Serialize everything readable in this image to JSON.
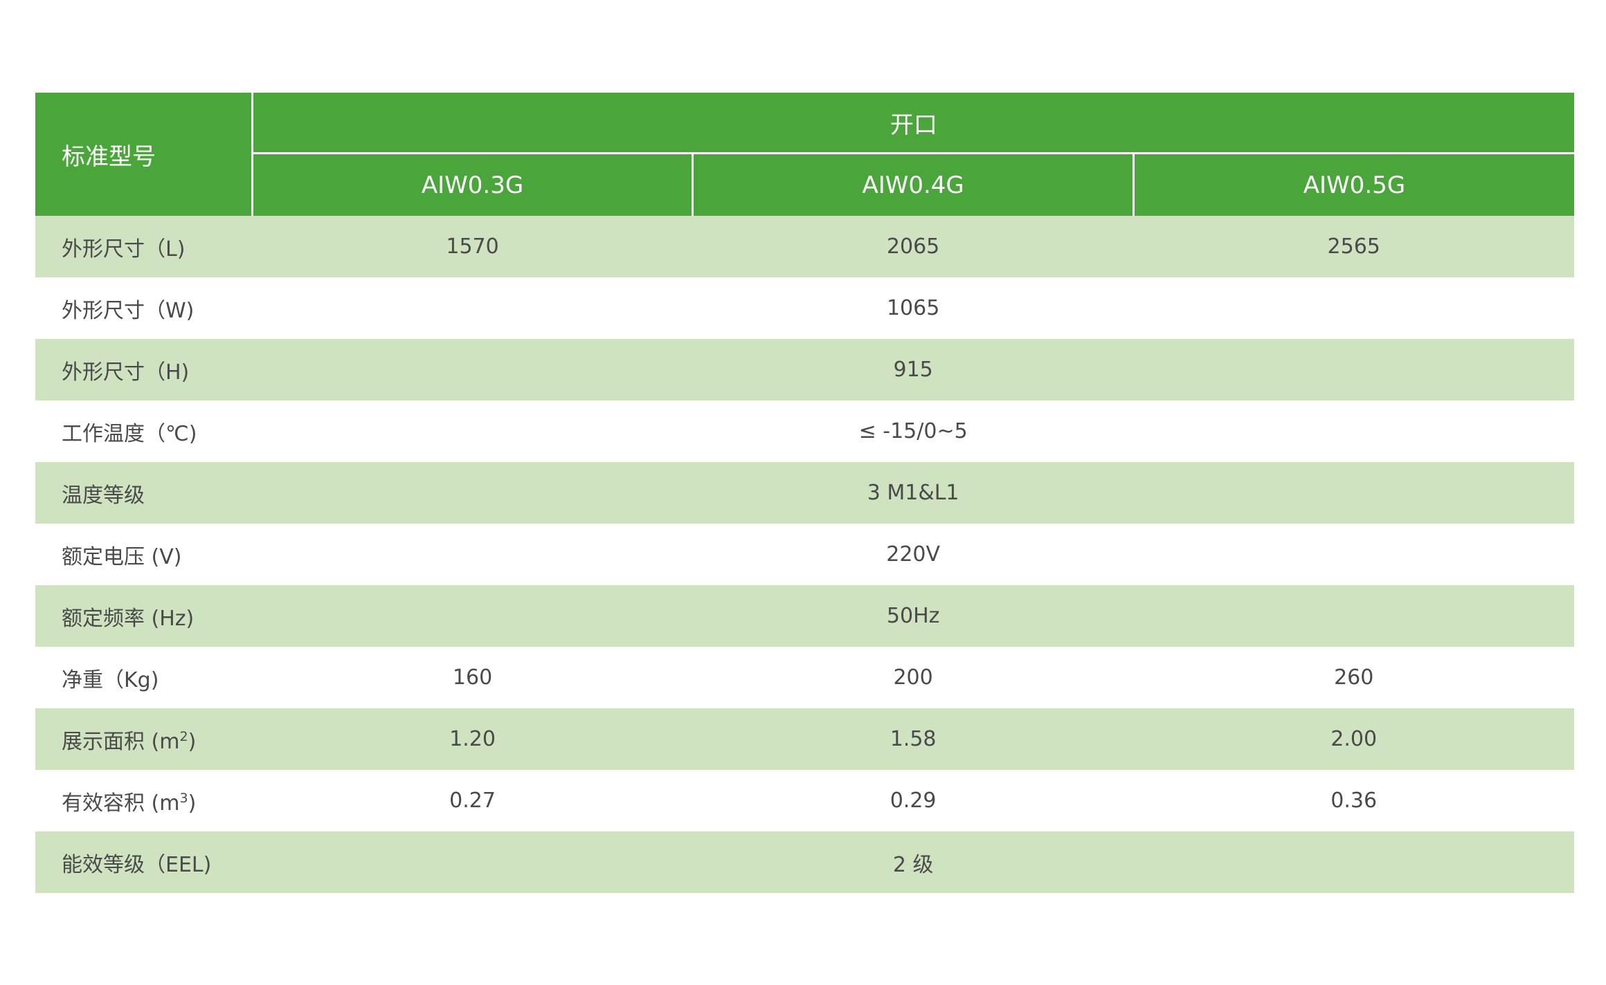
{
  "table": {
    "header": {
      "label": "标准型号",
      "group": "开口",
      "models": [
        "AIW0.3G",
        "AIW0.4G",
        "AIW0.5G"
      ]
    },
    "rows": [
      {
        "label": "外形尺寸（L)",
        "values": [
          "1570",
          "2065",
          "2565"
        ]
      },
      {
        "label": "外形尺寸（W)",
        "shared": "1065"
      },
      {
        "label": "外形尺寸（H)",
        "shared": "915"
      },
      {
        "label": "工作温度（℃)",
        "shared": "≤ -15/0~5"
      },
      {
        "label": "温度等级",
        "shared": "3 M1&L1"
      },
      {
        "label": "额定电压 (V)",
        "shared": "220V"
      },
      {
        "label": "额定频率 (Hz)",
        "shared": "50Hz"
      },
      {
        "label": "净重（Kg)",
        "values": [
          "160",
          "200",
          "260"
        ]
      },
      {
        "label": "展示面积 (m",
        "label_sup": "2",
        "label_suffix": ")",
        "values": [
          "1.20",
          "1.58",
          "2.00"
        ]
      },
      {
        "label": "有效容积 (m",
        "label_sup": "3",
        "label_suffix": ")",
        "values": [
          "0.27",
          "0.29",
          "0.36"
        ]
      },
      {
        "label": "能效等级（EEL)",
        "shared": "2 级"
      }
    ]
  },
  "colors": {
    "header_green": "#4aa53a",
    "stripe_green": "#cfe3c0",
    "text": "#4a4a4a"
  }
}
